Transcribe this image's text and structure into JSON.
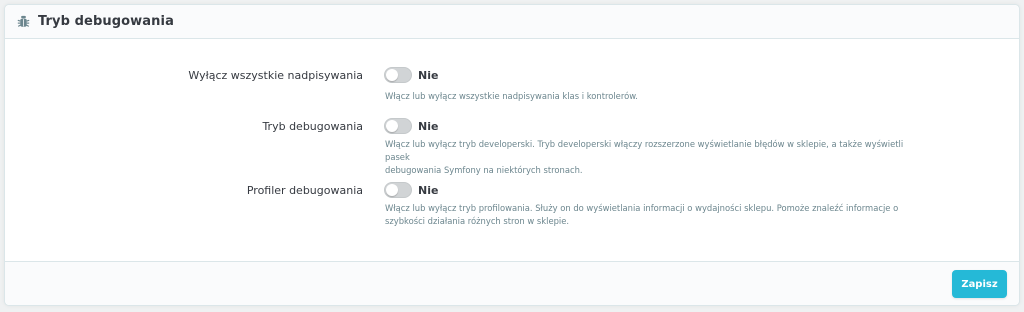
{
  "panel": {
    "title": "Tryb debugowania",
    "icon": "bug-icon"
  },
  "settings": [
    {
      "label": "Wyłącz wszystkie nadpisywania",
      "toggle_value": "Nie",
      "enabled": false,
      "help": "Włącz lub wyłącz wszystkie nadpisywania klas i kontrolerów."
    },
    {
      "label": "Tryb debugowania",
      "toggle_value": "Nie",
      "enabled": false,
      "help_line1": "Włącz lub wyłącz tryb developerski. Tryb developerski włączy rozszerzone wyświetlanie błędów w sklepie, a także wyświetli pasek",
      "help_line2": "debugowania Symfony na niektórych stronach."
    },
    {
      "label": "Profiler debugowania",
      "toggle_value": "Nie",
      "enabled": false,
      "help_line1": "Włącz lub wyłącz tryb profilowania. Służy on do wyświetlania informacji o wydajności sklepu. Pomoże znaleźć informacje o",
      "help_line2": "szybkości działania różnych stron w sklepie."
    }
  ],
  "footer": {
    "save_label": "Zapisz"
  },
  "colors": {
    "accent": "#25b9d7",
    "toggle_off": "#d1d4d6",
    "help_text": "#6c868e"
  }
}
